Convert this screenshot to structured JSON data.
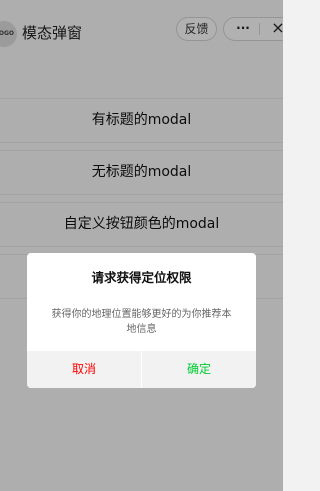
{
  "header": {
    "logo_text": "LOGO",
    "title": "模态弹窗",
    "feedback_label": "反馈",
    "more_icon": "···",
    "close_icon": "×"
  },
  "main": {
    "items": [
      {
        "label": "有标题的modal"
      },
      {
        "label": "无标题的modal"
      },
      {
        "label": "自定义按钮颜色的modal"
      },
      {
        "label": ""
      }
    ]
  },
  "modal": {
    "title": "请求获得定位权限",
    "content": "获得你的地理位置能够更好的为你推荐本地信息",
    "cancel_label": "取消",
    "confirm_label": "确定",
    "colors": {
      "cancel": "#ff0000",
      "confirm": "#00cc33"
    }
  }
}
